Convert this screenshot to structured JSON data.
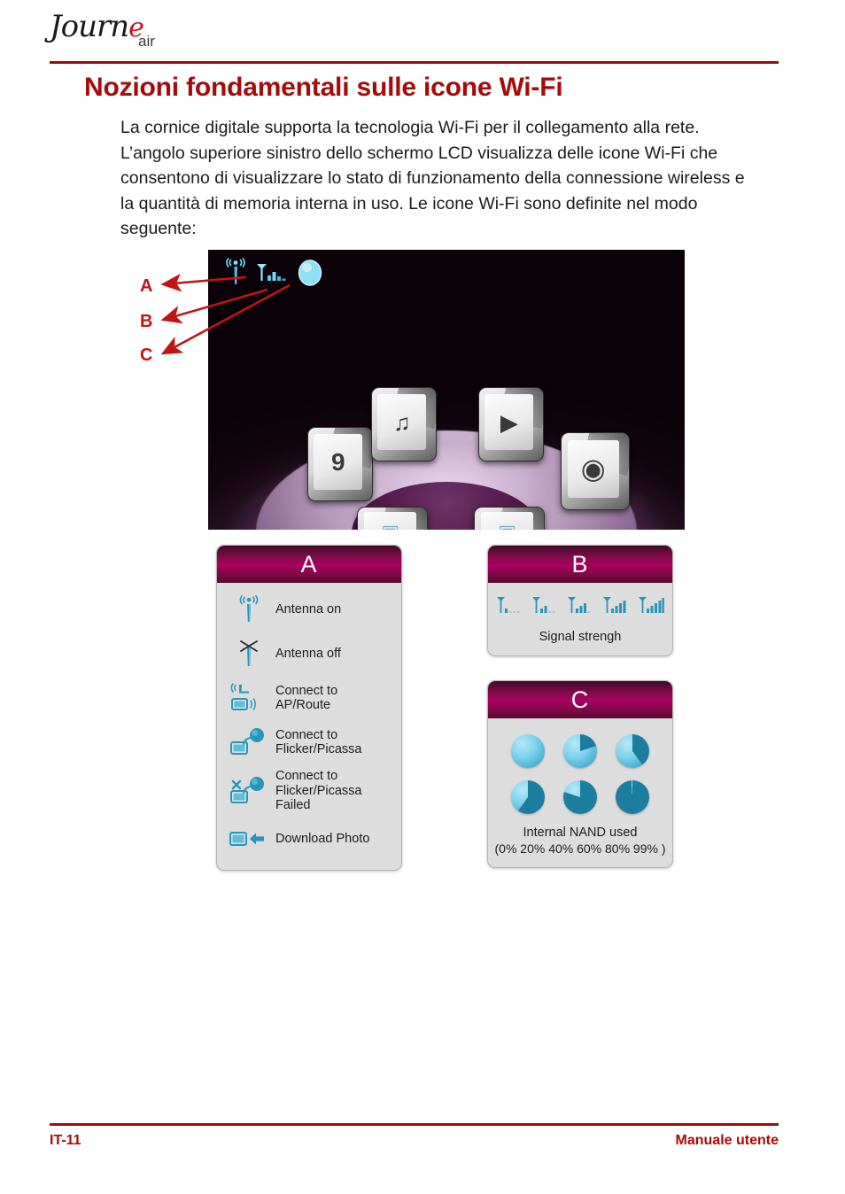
{
  "brand": {
    "logo_main": "Journ",
    "logo_accent_letter": "e",
    "logo_sub": "air"
  },
  "title": "Nozioni fondamentali sulle icone Wi-Fi",
  "intro": "La cornice digitale supporta la tecnologia Wi-Fi per il collegamento alla rete. L’angolo superiore sinistro dello schermo LCD visualizza delle icone Wi-Fi che consentono di visualizzare lo stato di funzionamento della connessione wireless e la quantità di memoria interna in uso. Le icone Wi-Fi sono definite nel modo seguente:",
  "colors": {
    "title_red": "#a80a0a",
    "rule_red": "#9e0b0b",
    "callout_red": "#c01515",
    "panel_header_magenta": "#a8005f",
    "panel_header_dark": "#3f0a27",
    "panel_body_gray": "#dddddd",
    "icon_teal": "#2796bb",
    "icon_teal_dark": "#12647f",
    "logo_accent": "#cc1122"
  },
  "callouts": [
    {
      "label": "A",
      "target": "antenna-status-icon"
    },
    {
      "label": "B",
      "target": "signal-strength-icon"
    },
    {
      "label": "C",
      "target": "nand-usage-icon"
    }
  ],
  "lcd_screen": {
    "status_icons": [
      "antenna-on-icon",
      "signal-bars-icon",
      "nand-pie-icon"
    ],
    "menu_tiles": [
      {
        "name": "calendar",
        "glyph": "9"
      },
      {
        "name": "photo-music",
        "glyph": "♫"
      },
      {
        "name": "video",
        "glyph": "▶"
      },
      {
        "name": "speaker",
        "glyph": "◉"
      },
      {
        "name": "photo-1",
        "glyph": "▣"
      },
      {
        "name": "photo-2",
        "glyph": "▣"
      }
    ]
  },
  "panels": {
    "a": {
      "letter": "A",
      "rows": [
        {
          "icon": "antenna-on-icon",
          "text": "Antenna on"
        },
        {
          "icon": "antenna-off-icon",
          "text": "Antenna off"
        },
        {
          "icon": "connect-ap-icon",
          "text": "Connect to\nAP/Route"
        },
        {
          "icon": "connect-flickr-icon",
          "text": "Connect to\nFlicker/Picassa"
        },
        {
          "icon": "connect-flickr-failed-icon",
          "text": "Connect to\nFlicker/Picassa Failed"
        },
        {
          "icon": "download-photo-icon",
          "text": "Download Photo"
        }
      ]
    },
    "b": {
      "letter": "B",
      "caption": "Signal strengh",
      "levels": [
        1,
        2,
        3,
        4,
        5
      ],
      "max_bars": 5
    },
    "c": {
      "letter": "C",
      "caption": "Internal NAND used",
      "caption_sub": "(0% 20% 40% 60% 80% 99% )",
      "percentages": [
        0,
        20,
        40,
        60,
        80,
        99
      ]
    }
  },
  "footer": {
    "page_number": "IT-11",
    "doc_title": "Manuale utente"
  }
}
